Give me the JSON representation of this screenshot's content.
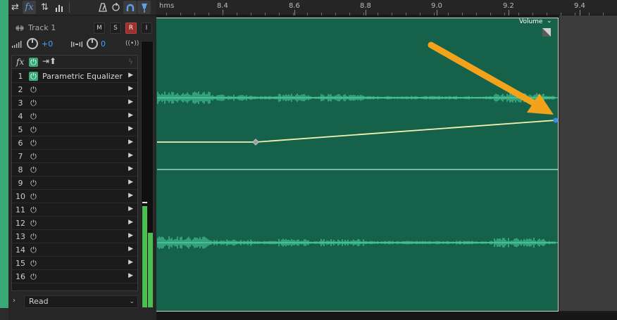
{
  "toolbar": {
    "buttons": [
      {
        "name": "swap-icon",
        "glyph": "⇄"
      },
      {
        "name": "fx-icon",
        "glyph": "fx"
      },
      {
        "name": "input-output-icon",
        "glyph": "⇅"
      },
      {
        "name": "bars-icon",
        "glyph": "▮"
      },
      {
        "name": "metronome-icon",
        "glyph": "◭"
      },
      {
        "name": "sync-icon",
        "glyph": "⇵"
      },
      {
        "name": "magnet-icon",
        "glyph": "∩"
      },
      {
        "name": "pin-icon",
        "glyph": "⬇"
      }
    ]
  },
  "track": {
    "name": "Track 1",
    "mute_label": "M",
    "solo_label": "S",
    "record_label": "R",
    "input_label": "I",
    "volume_value": "+0",
    "pan_value": "0"
  },
  "effects_rack": {
    "slots": [
      {
        "num": "1",
        "name": "Parametric Equalizer",
        "enabled": true
      },
      {
        "num": "2",
        "name": "",
        "enabled": false
      },
      {
        "num": "3",
        "name": "",
        "enabled": false
      },
      {
        "num": "4",
        "name": "",
        "enabled": false
      },
      {
        "num": "5",
        "name": "",
        "enabled": false
      },
      {
        "num": "6",
        "name": "",
        "enabled": false
      },
      {
        "num": "7",
        "name": "",
        "enabled": false
      },
      {
        "num": "8",
        "name": "",
        "enabled": false
      },
      {
        "num": "9",
        "name": "",
        "enabled": false
      },
      {
        "num": "10",
        "name": "",
        "enabled": false
      },
      {
        "num": "11",
        "name": "",
        "enabled": false
      },
      {
        "num": "12",
        "name": "",
        "enabled": false
      },
      {
        "num": "13",
        "name": "",
        "enabled": false
      },
      {
        "num": "14",
        "name": "",
        "enabled": false
      },
      {
        "num": "15",
        "name": "",
        "enabled": false
      },
      {
        "num": "16",
        "name": "",
        "enabled": false
      }
    ]
  },
  "meter": {
    "left_level": 0.38,
    "right_level": 0.28
  },
  "automation_mode": "Read",
  "ruler": {
    "unit_label": "hms",
    "ticks": [
      "8.4",
      "8.6",
      "8.8",
      "9.0",
      "9.2",
      "9.4"
    ]
  },
  "clip": {
    "envelope_label": "Volume",
    "colors": {
      "clip_bg": "#166149",
      "waveform": "#52e0ad",
      "envelope": "#f4f1b4",
      "arrow": "#f2a31b"
    }
  }
}
